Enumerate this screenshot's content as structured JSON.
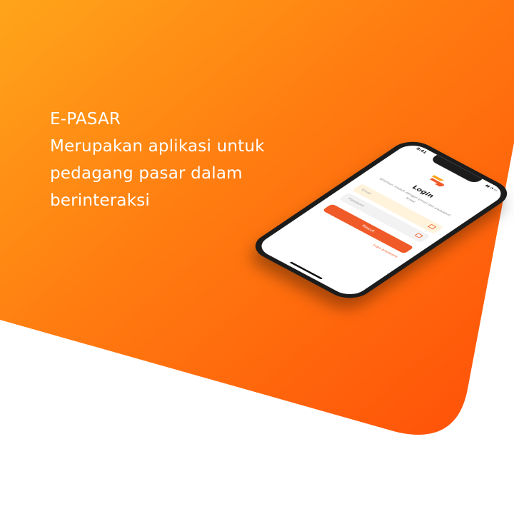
{
  "headline": {
    "line1": "E-PASAR",
    "line2": "Merupakan aplikasi untuk",
    "line3": "pedagang pasar dalam",
    "line4": "berinteraksi"
  },
  "phone": {
    "status_time": "9:41",
    "login_title": "Login",
    "login_subtitle": "Silahkan masuk dengan email dan password Anda!",
    "email_placeholder": "Email",
    "password_placeholder": "Password",
    "submit_label": "Masuk",
    "forgot_label": "Lupa password"
  },
  "colors": {
    "gradient_start": "#ffa51a",
    "gradient_end": "#ff5a0a",
    "accent": "#f05a28"
  }
}
